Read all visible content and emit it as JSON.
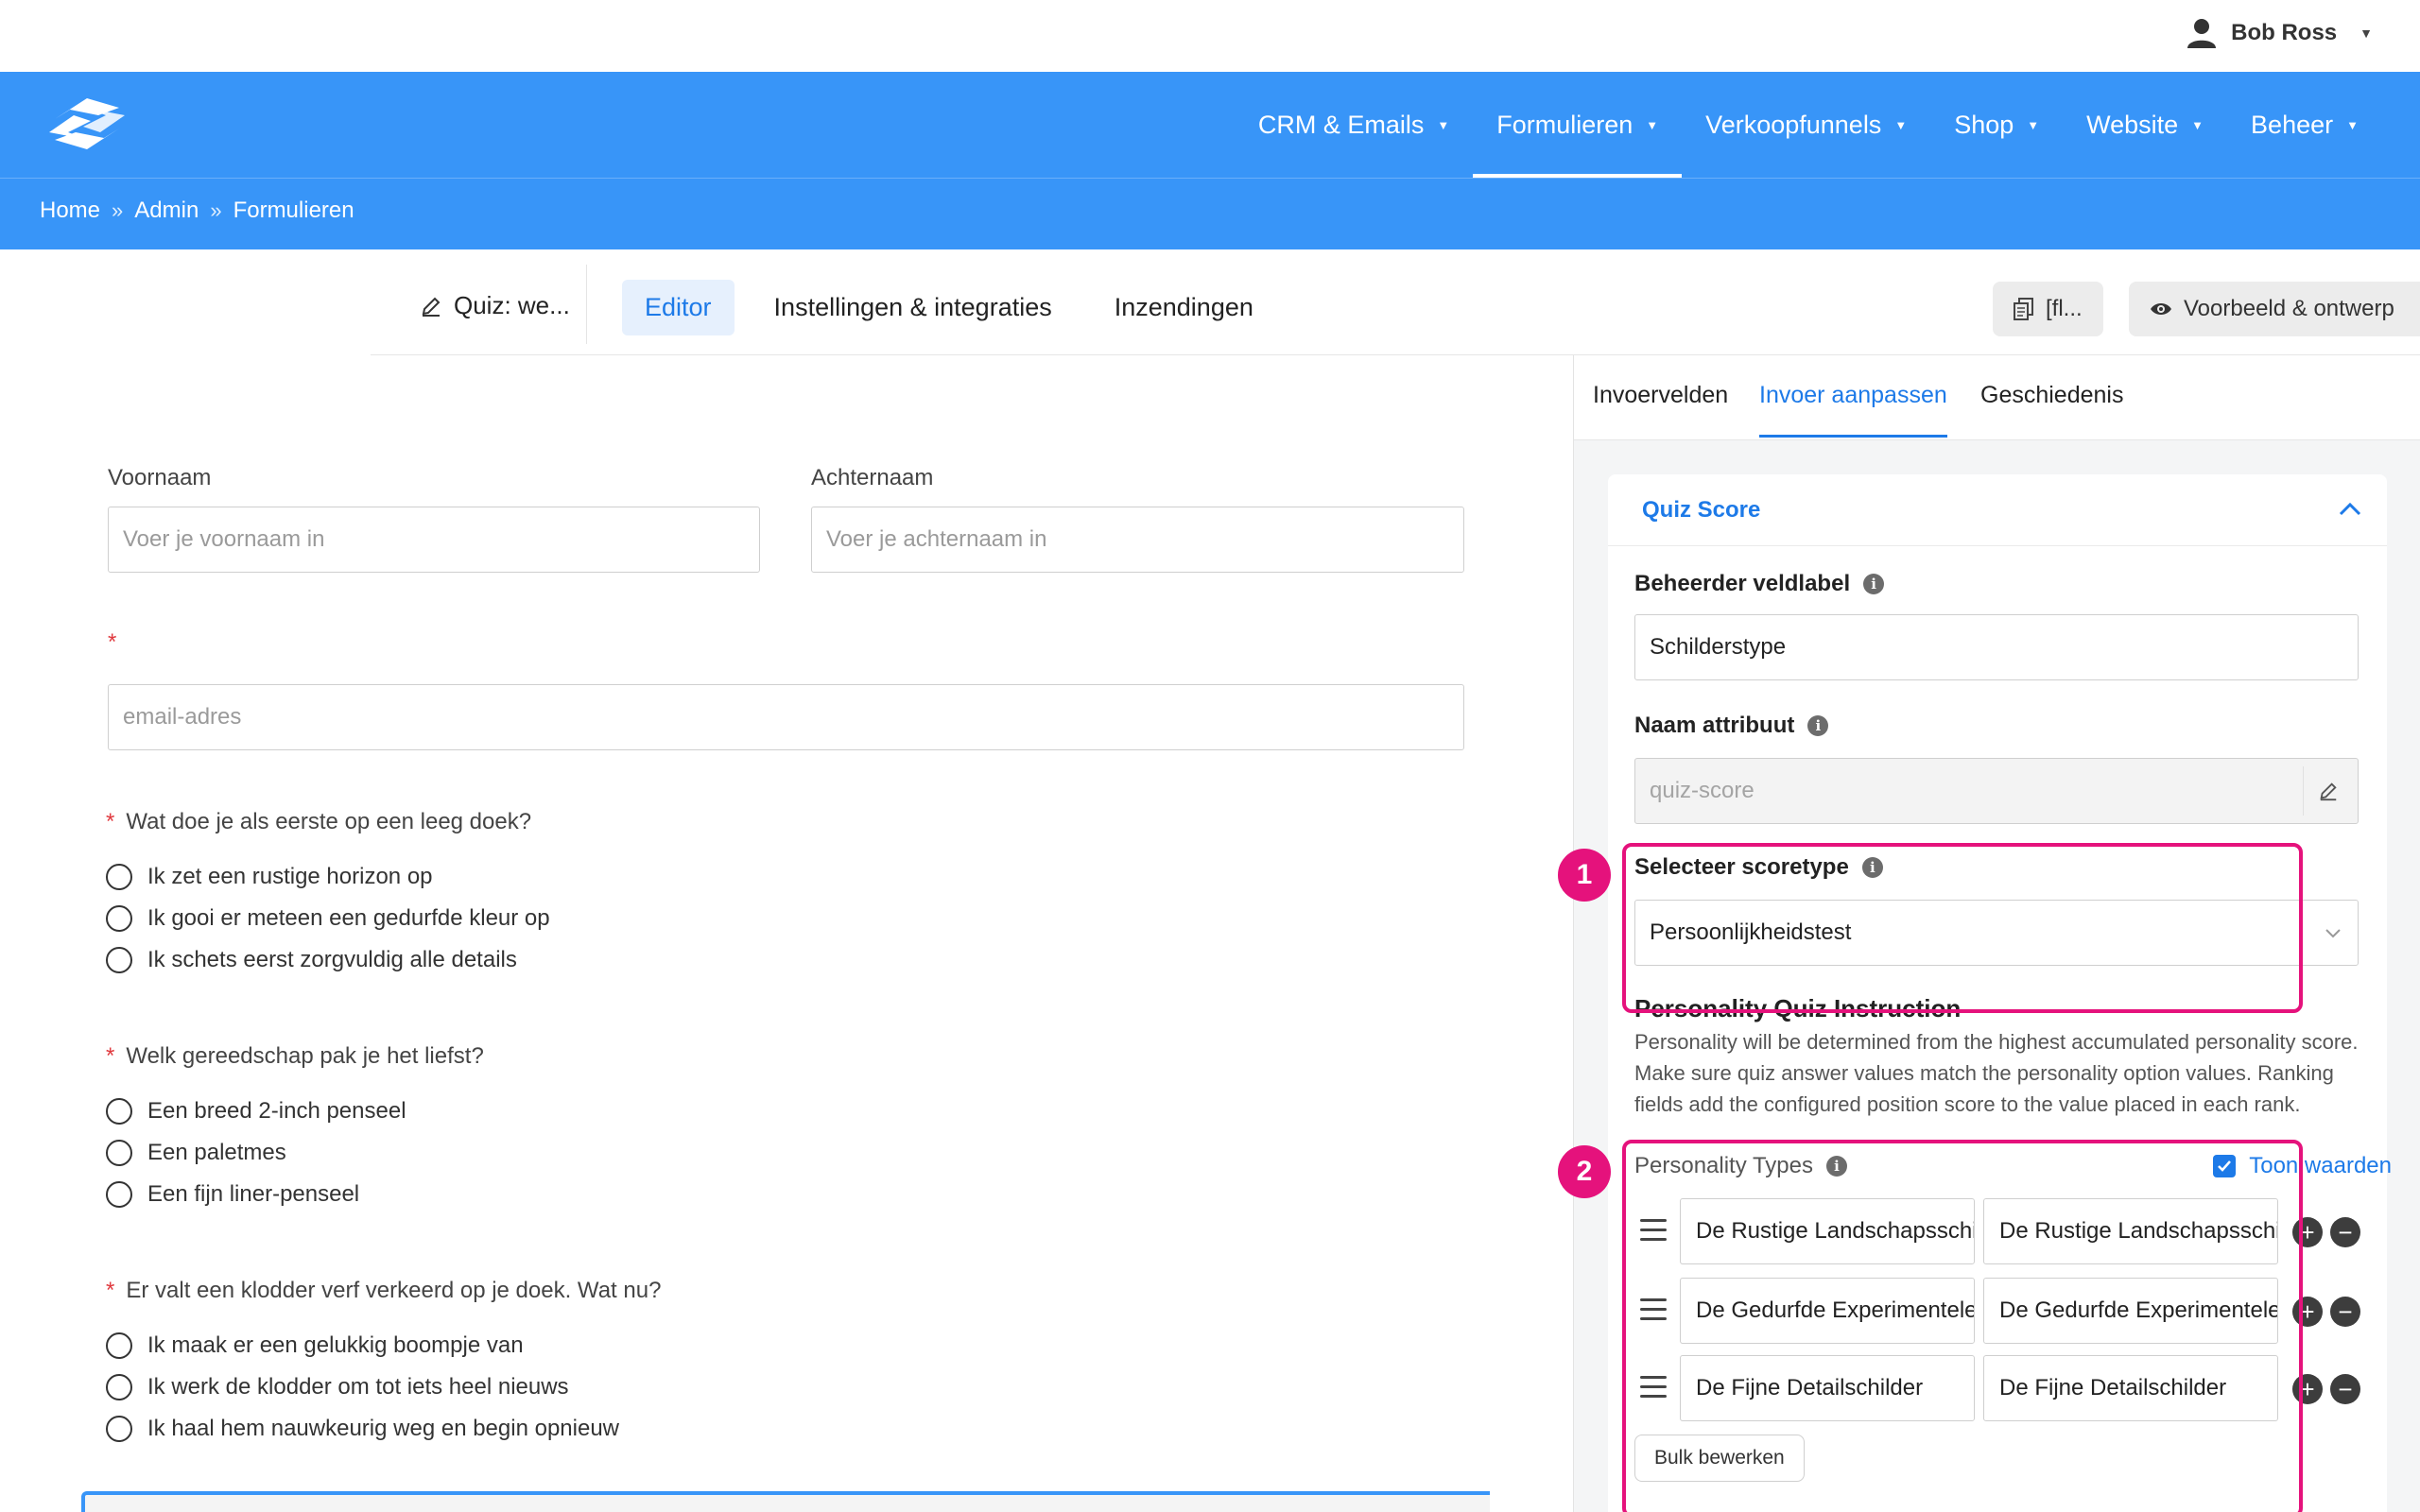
{
  "user": {
    "name": "Bob Ross"
  },
  "nav": {
    "items": [
      {
        "label": "CRM & Emails"
      },
      {
        "label": "Formulieren"
      },
      {
        "label": "Verkoopfunnels"
      },
      {
        "label": "Shop"
      },
      {
        "label": "Website"
      },
      {
        "label": "Beheer"
      }
    ],
    "active": "Formulieren"
  },
  "breadcrumb": {
    "items": [
      "Home",
      "Admin",
      "Formulieren"
    ],
    "separator": "»"
  },
  "toolbar": {
    "form_title": "Quiz: we...",
    "tabs": [
      {
        "label": "Editor"
      },
      {
        "label": "Instellingen & integraties"
      },
      {
        "label": "Inzendingen"
      }
    ],
    "shortcode_label": "[fl...",
    "preview_label": "Voorbeeld & ontwerp"
  },
  "form": {
    "first_name": {
      "label": "Voornaam",
      "placeholder": "Voer je voornaam in"
    },
    "last_name": {
      "label": "Achternaam",
      "placeholder": "Voer je achternaam in"
    },
    "email": {
      "required_mark": "*",
      "placeholder": "email-adres"
    },
    "questions": [
      {
        "required_mark": "*",
        "text": "Wat doe je als eerste op een leeg doek?",
        "options": [
          "Ik zet een rustige horizon op",
          "Ik gooi er meteen een gedurfde kleur op",
          "Ik schets eerst zorgvuldig alle details"
        ]
      },
      {
        "required_mark": "*",
        "text": "Welk gereedschap pak je het liefst?",
        "options": [
          "Een breed 2-inch penseel",
          "Een paletmes",
          "Een fijn liner-penseel"
        ]
      },
      {
        "required_mark": "*",
        "text": "Er valt een klodder verf verkeerd op je doek. Wat nu?",
        "options": [
          "Ik maak er een gelukkig boompje van",
          "Ik werk de klodder om tot iets heel nieuws",
          "Ik haal hem nauwkeurig weg en begin opnieuw"
        ]
      }
    ]
  },
  "panel": {
    "tabs": [
      {
        "label": "Invoervelden"
      },
      {
        "label": "Invoer aanpassen"
      },
      {
        "label": "Geschiedenis"
      }
    ],
    "active_tab": "Invoer aanpassen",
    "section_title": "Quiz Score",
    "admin_label": {
      "label": "Beheerder veldlabel",
      "value": "Schilderstype"
    },
    "attribute_name": {
      "label": "Naam attribuut",
      "value": "quiz-score"
    },
    "score_type": {
      "label": "Selecteer scoretype",
      "value": "Persoonlijkheidstest"
    },
    "instruction": {
      "title": "Personality Quiz Instruction",
      "text": "Personality will be determined from the highest accumulated personality score. Make sure quiz answer values match the personality option values. Ranking fields add the configured position score to the value placed in each rank."
    },
    "personality_types": {
      "label": "Personality Types",
      "show_values_label": "Toon waarden",
      "show_values_checked": true,
      "rows": [
        {
          "label": "De Rustige Landschapsschilder",
          "value": "De Rustige Landschapsschilder"
        },
        {
          "label": "De Gedurfde Experimentele",
          "value": "De Gedurfde Experimentele"
        },
        {
          "label": "De Fijne Detailschilder",
          "value": "De Fijne Detailschilder"
        }
      ]
    },
    "bulk_edit_label": "Bulk bewerken"
  },
  "annotations": [
    {
      "number": "1"
    },
    {
      "number": "2"
    }
  ],
  "colors": {
    "brand": "#3895f8",
    "accent": "#1d7ae8",
    "annotation": "#e5127c"
  }
}
